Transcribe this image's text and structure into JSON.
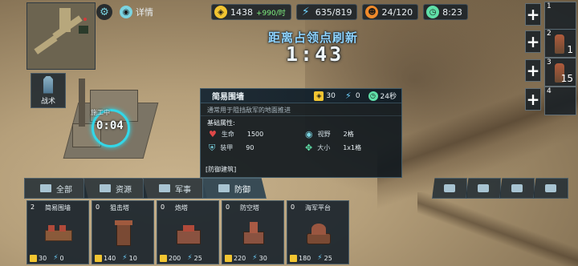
{
  "top_bar": {
    "details_label": "详情",
    "gold": "1438",
    "gold_rate": "+990/时",
    "energy": "635/819",
    "population": "24/120",
    "time": "8:23"
  },
  "minimap": {
    "battle_label": "战术"
  },
  "refresh": {
    "title": "距离占领点刷新",
    "countdown": "1:43"
  },
  "construction": {
    "label": "施工中",
    "timer": "0:04"
  },
  "side_slots": [
    {
      "index": "1",
      "count": ""
    },
    {
      "index": "2",
      "count": "1"
    },
    {
      "index": "3",
      "count": "15"
    },
    {
      "index": "4",
      "count": ""
    }
  ],
  "info_panel": {
    "name": "简易围墙",
    "gold_cost": "30",
    "energy_cost": "0",
    "build_time": "24秒",
    "description": "通常用于阻挡敌军的地面推进",
    "section_title": "基础属性:",
    "attributes": {
      "hp_label": "生命",
      "hp_value": "1500",
      "vision_label": "视野",
      "vision_value": "2格",
      "armor_label": "装甲",
      "armor_value": "90",
      "size_label": "大小",
      "size_value": "1x1格"
    },
    "tag": "[防御建筑]"
  },
  "tabs": [
    {
      "label": "全部"
    },
    {
      "label": "资源"
    },
    {
      "label": "军事"
    },
    {
      "label": "防御"
    }
  ],
  "cards": [
    {
      "qty": "2",
      "name": "简易围墙",
      "gold": "30",
      "energy": "0"
    },
    {
      "qty": "0",
      "name": "狙击塔",
      "gold": "140",
      "energy": "10"
    },
    {
      "qty": "0",
      "name": "炮塔",
      "gold": "200",
      "energy": "25"
    },
    {
      "qty": "0",
      "name": "防空塔",
      "gold": "220",
      "energy": "30"
    },
    {
      "qty": "0",
      "name": "海军平台",
      "gold": "180",
      "energy": "25"
    }
  ],
  "colors": {
    "accent": "#33d7e8",
    "gold": "#f2c531",
    "energy": "#6ed3ff",
    "hp": "#e04848"
  }
}
